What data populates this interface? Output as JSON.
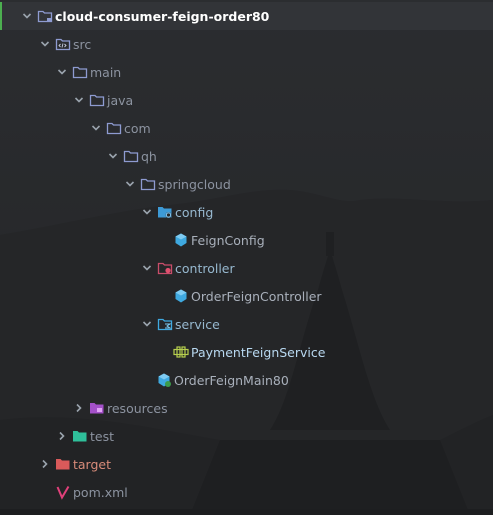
{
  "tree": {
    "root": {
      "label": "cloud-consumer-feign-order80",
      "icon": "folder-module-icon"
    },
    "src": {
      "label": "src",
      "icon": "folder-src-icon"
    },
    "main": {
      "label": "main",
      "icon": "folder-icon"
    },
    "java": {
      "label": "java",
      "icon": "folder-source-root-icon"
    },
    "com": {
      "label": "com",
      "icon": "package-icon"
    },
    "qh": {
      "label": "qh",
      "icon": "package-icon"
    },
    "springcloud": {
      "label": "springcloud",
      "icon": "package-icon"
    },
    "config": {
      "label": "config",
      "icon": "folder-config-icon"
    },
    "feignConfig": {
      "label": "FeignConfig",
      "icon": "class-icon"
    },
    "controller": {
      "label": "controller",
      "icon": "folder-controller-icon"
    },
    "orderFeignController": {
      "label": "OrderFeignController",
      "icon": "class-icon"
    },
    "service": {
      "label": "service",
      "icon": "folder-service-icon"
    },
    "paymentFeignService": {
      "label": "PaymentFeignService",
      "icon": "interface-icon"
    },
    "orderFeignMain80": {
      "label": "OrderFeignMain80",
      "icon": "spring-boot-class-icon"
    },
    "resources": {
      "label": "resources",
      "icon": "folder-resources-icon"
    },
    "test": {
      "label": "test",
      "icon": "folder-test-icon"
    },
    "target": {
      "label": "target",
      "icon": "folder-target-icon"
    },
    "pom": {
      "label": "pom.xml",
      "icon": "maven-icon"
    }
  },
  "colors": {
    "background": "#27292b",
    "selected_row": "#323438",
    "selected_accent": "#4caf50",
    "folder": "#8e9bd1",
    "class": "#3fa9e0",
    "target_folder": "#e06b6b",
    "test_folder": "#35c9a6",
    "resources_folder": "#b05ed1",
    "maven": "#e0407a"
  }
}
